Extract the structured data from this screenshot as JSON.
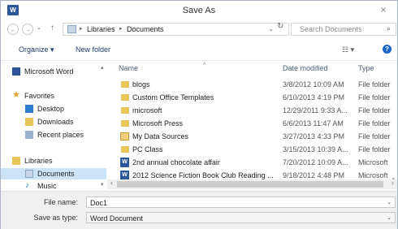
{
  "window": {
    "title": "Save As",
    "close_glyph": "×",
    "app_icon_letter": "W"
  },
  "address": {
    "crumbs": [
      "Libraries",
      "Documents"
    ],
    "search_placeholder": "Search Documents"
  },
  "toolbar": {
    "organize_label": "Organize",
    "new_folder_label": "New folder"
  },
  "nav": {
    "items": [
      {
        "label": "Microsoft Word",
        "icon": "word-icon"
      },
      {
        "label": "Favorites",
        "icon": "star-icon"
      },
      {
        "label": "Desktop",
        "icon": "desktop-icon"
      },
      {
        "label": "Downloads",
        "icon": "downloads-icon"
      },
      {
        "label": "Recent places",
        "icon": "recent-places-icon"
      },
      {
        "label": "Libraries",
        "icon": "libraries-icon"
      },
      {
        "label": "Documents",
        "icon": "documents-icon",
        "selected": true
      },
      {
        "label": "Music",
        "icon": "music-icon"
      }
    ]
  },
  "columns": {
    "name": "Name",
    "date": "Date modified",
    "type": "Type"
  },
  "files": [
    {
      "name": "blogs",
      "date": "3/8/2012 10:09 AM",
      "type": "File folder",
      "icon": "folder"
    },
    {
      "name": "Custom Office Templates",
      "date": "6/10/2013 4:19 PM",
      "type": "File folder",
      "icon": "folder"
    },
    {
      "name": "microsoft",
      "date": "12/29/2011 9:33 A...",
      "type": "File folder",
      "icon": "folder"
    },
    {
      "name": "Microsoft Press",
      "date": "6/6/2013 11:47 AM",
      "type": "File folder",
      "icon": "folder"
    },
    {
      "name": "My Data Sources",
      "date": "3/27/2013 4:33 PM",
      "type": "File folder",
      "icon": "datasource"
    },
    {
      "name": "PC Class",
      "date": "3/15/2013 10:39 A...",
      "type": "File folder",
      "icon": "folder"
    },
    {
      "name": "2nd annual chocolate affair",
      "date": "7/20/2012 10:09 A...",
      "type": "Microsoft",
      "icon": "doc"
    },
    {
      "name": "2012 Science Fiction Book Club Reading ...",
      "date": "9/18/2012 4:48 PM",
      "type": "Microsoft",
      "icon": "doc"
    }
  ],
  "bottom": {
    "filename_label": "File name:",
    "filename_value": "Doc1",
    "savetype_label": "Save as type:",
    "savetype_value": "Word Document"
  },
  "colors": {
    "accent": "#2b579a",
    "selection": "#cce4f7",
    "folder": "#e8c45a"
  }
}
